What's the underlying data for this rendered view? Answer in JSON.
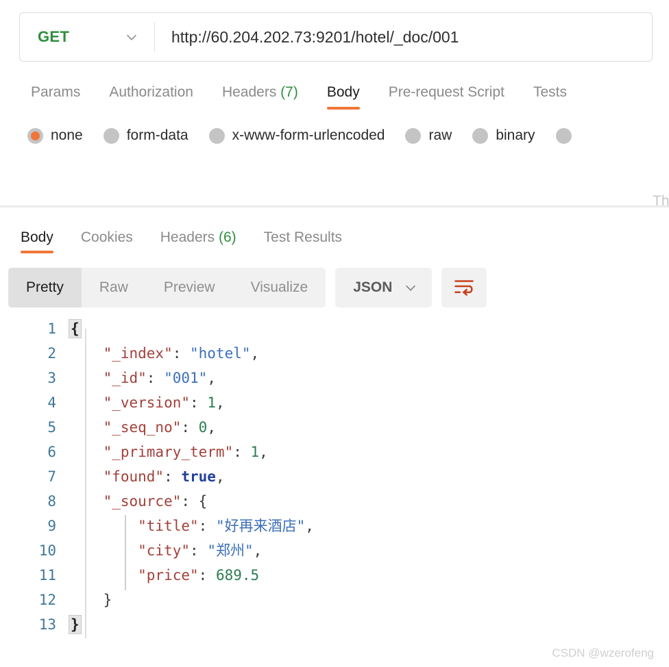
{
  "request": {
    "method": "GET",
    "method_chevron_icon": "chevron-down-icon",
    "url": "http://60.204.202.73:9201/hotel/_doc/001",
    "tabs": [
      {
        "label": "Params",
        "count": "",
        "active": false
      },
      {
        "label": "Authorization",
        "count": "",
        "active": false
      },
      {
        "label": "Headers",
        "count": "(7)",
        "active": false
      },
      {
        "label": "Body",
        "count": "",
        "active": true
      },
      {
        "label": "Pre-request Script",
        "count": "",
        "active": false
      },
      {
        "label": "Tests",
        "count": "",
        "active": false
      }
    ],
    "body_types": [
      {
        "label": "none",
        "selected": true
      },
      {
        "label": "form-data",
        "selected": false
      },
      {
        "label": "x-www-form-urlencoded",
        "selected": false
      },
      {
        "label": "raw",
        "selected": false
      },
      {
        "label": "binary",
        "selected": false
      },
      {
        "label": "",
        "selected": false
      }
    ],
    "ghost_hint": "Th"
  },
  "response": {
    "tabs": [
      {
        "label": "Body",
        "count": "",
        "active": true
      },
      {
        "label": "Cookies",
        "count": "",
        "active": false
      },
      {
        "label": "Headers",
        "count": "(6)",
        "active": false
      },
      {
        "label": "Test Results",
        "count": "",
        "active": false
      }
    ],
    "view_modes": [
      {
        "label": "Pretty",
        "active": true
      },
      {
        "label": "Raw",
        "active": false
      },
      {
        "label": "Preview",
        "active": false
      },
      {
        "label": "Visualize",
        "active": false
      }
    ],
    "format": "JSON",
    "format_chevron_icon": "chevron-down-icon",
    "wrap_icon": "word-wrap-icon",
    "code_lines": [
      {
        "num": "1",
        "segments": [
          {
            "t": "{",
            "c": "brace-hl"
          }
        ]
      },
      {
        "num": "2",
        "segments": [
          {
            "t": "    \"_index\"",
            "c": "k"
          },
          {
            "t": ": ",
            "c": "p"
          },
          {
            "t": "\"hotel\"",
            "c": "s"
          },
          {
            "t": ",",
            "c": "p"
          }
        ]
      },
      {
        "num": "3",
        "segments": [
          {
            "t": "    \"_id\"",
            "c": "k"
          },
          {
            "t": ": ",
            "c": "p"
          },
          {
            "t": "\"001\"",
            "c": "s"
          },
          {
            "t": ",",
            "c": "p"
          }
        ]
      },
      {
        "num": "4",
        "segments": [
          {
            "t": "    \"_version\"",
            "c": "k"
          },
          {
            "t": ": ",
            "c": "p"
          },
          {
            "t": "1",
            "c": "n"
          },
          {
            "t": ",",
            "c": "p"
          }
        ]
      },
      {
        "num": "5",
        "segments": [
          {
            "t": "    \"_seq_no\"",
            "c": "k"
          },
          {
            "t": ": ",
            "c": "p"
          },
          {
            "t": "0",
            "c": "n"
          },
          {
            "t": ",",
            "c": "p"
          }
        ]
      },
      {
        "num": "6",
        "segments": [
          {
            "t": "    \"_primary_term\"",
            "c": "k"
          },
          {
            "t": ": ",
            "c": "p"
          },
          {
            "t": "1",
            "c": "n"
          },
          {
            "t": ",",
            "c": "p"
          }
        ]
      },
      {
        "num": "7",
        "segments": [
          {
            "t": "    \"found\"",
            "c": "k"
          },
          {
            "t": ": ",
            "c": "p"
          },
          {
            "t": "true",
            "c": "b"
          },
          {
            "t": ",",
            "c": "p"
          }
        ]
      },
      {
        "num": "8",
        "segments": [
          {
            "t": "    \"_source\"",
            "c": "k"
          },
          {
            "t": ": ",
            "c": "p"
          },
          {
            "t": "{",
            "c": "p"
          }
        ]
      },
      {
        "num": "9",
        "segments": [
          {
            "t": "        \"title\"",
            "c": "k"
          },
          {
            "t": ": ",
            "c": "p"
          },
          {
            "t": "\"好再来酒店\"",
            "c": "s"
          },
          {
            "t": ",",
            "c": "p"
          }
        ]
      },
      {
        "num": "10",
        "segments": [
          {
            "t": "        \"city\"",
            "c": "k"
          },
          {
            "t": ": ",
            "c": "p"
          },
          {
            "t": "\"郑州\"",
            "c": "s"
          },
          {
            "t": ",",
            "c": "p"
          }
        ]
      },
      {
        "num": "11",
        "segments": [
          {
            "t": "        \"price\"",
            "c": "k"
          },
          {
            "t": ": ",
            "c": "p"
          },
          {
            "t": "689.5",
            "c": "n"
          }
        ]
      },
      {
        "num": "12",
        "segments": [
          {
            "t": "    }",
            "c": "p"
          }
        ]
      },
      {
        "num": "13",
        "segments": [
          {
            "t": "}",
            "c": "brace-hl"
          }
        ]
      }
    ]
  },
  "watermark": "CSDN @wzerofeng",
  "colors": {
    "accent_orange": "#ef7638",
    "method_green": "#2f8f3e",
    "json_key": "#a3403a",
    "json_string": "#3b6fb8",
    "json_number": "#2a7d4f",
    "json_boolean": "#21419b",
    "line_number": "#3f7799"
  }
}
